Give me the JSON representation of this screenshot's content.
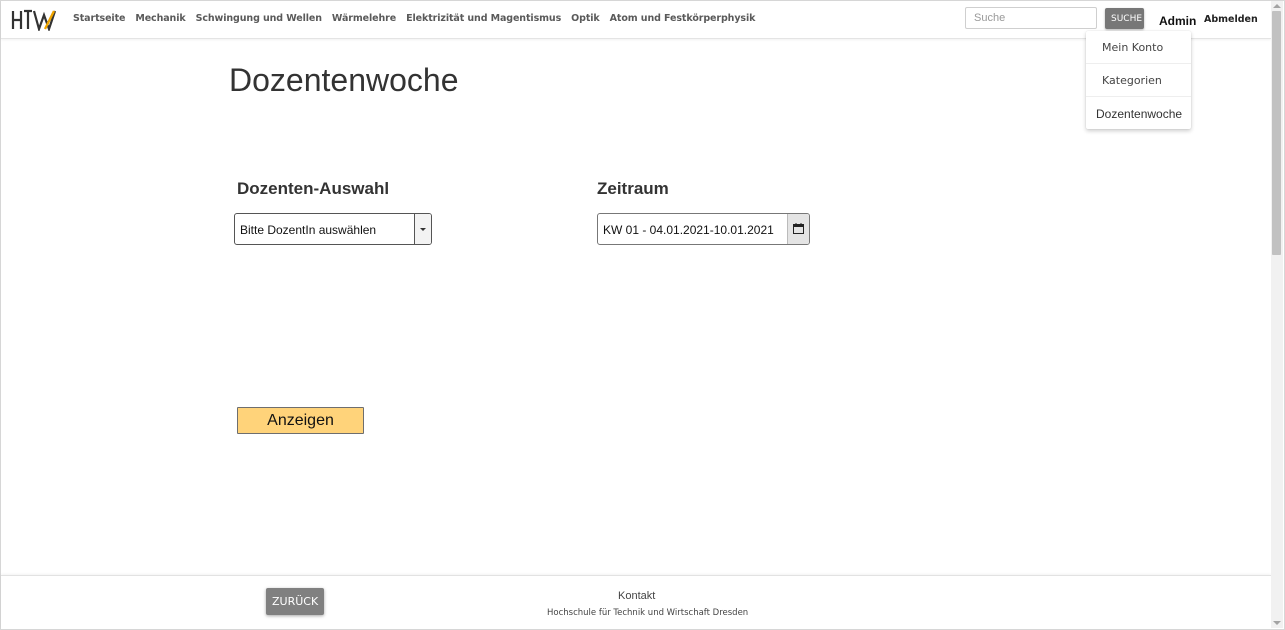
{
  "navbar": {
    "logo_text": "HTW",
    "links": [
      "Startseite",
      "Mechanik",
      "Schwingung und Wellen",
      "Wärmelehre",
      "Elektrizität und Magentismus",
      "Optik",
      "Atom und Festkörperphysik"
    ],
    "search_placeholder": "Suche",
    "search_button": "SUCHE",
    "user_label": "Admin",
    "logout_label": "Abmelden"
  },
  "dropdown": {
    "items": [
      "Mein Konto",
      "Kategorien",
      "Dozentenwoche"
    ]
  },
  "main": {
    "title": "Dozentenwoche",
    "lecturer_label": "Dozenten-Auswahl",
    "lecturer_select_value": "Bitte DozentIn auswählen",
    "period_label": "Zeitraum",
    "period_value": "KW 01 - 04.01.2021-10.01.2021",
    "show_button": "Anzeigen"
  },
  "footer": {
    "back_button": "ZURÜCK",
    "contact_label": "Kontakt",
    "institution": "Hochschule für Technik und Wirtschaft Dresden"
  },
  "colors": {
    "logo_accent": "#f0a500",
    "show_button_bg": "#ffd37a",
    "button_gray": "#808080"
  },
  "icons": {
    "calendar": "calendar-icon",
    "select_arrow": "chevron-down-icon"
  }
}
